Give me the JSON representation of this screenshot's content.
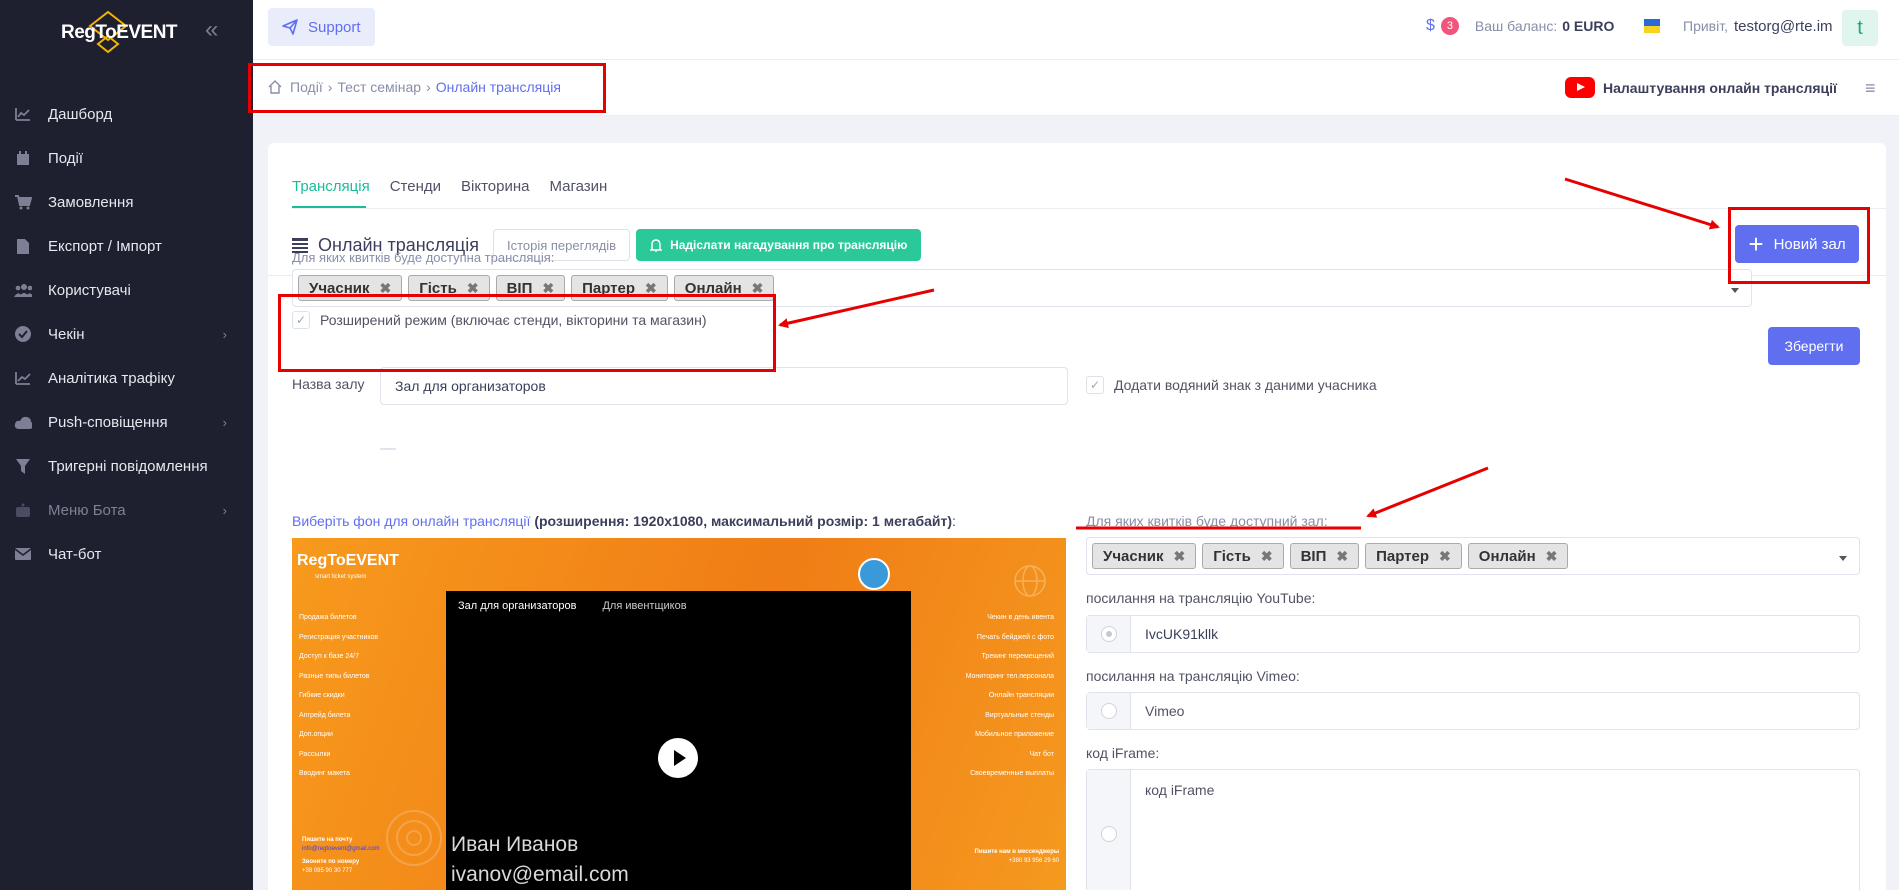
{
  "app": {
    "logo": "RegToEVENT",
    "collapse_icon": "chevron-double-left-icon"
  },
  "sidebar": {
    "items": [
      {
        "label": "Дашборд",
        "icon": "chart-icon"
      },
      {
        "label": "Події",
        "icon": "calendar-icon"
      },
      {
        "label": "Замовлення",
        "icon": "cart-icon"
      },
      {
        "label": "Експорт / Імпорт",
        "icon": "file-icon"
      },
      {
        "label": "Користувачі",
        "icon": "users-icon"
      },
      {
        "label": "Чекін",
        "icon": "check-circle-icon",
        "has_children": true
      },
      {
        "label": "Аналітика трафіку",
        "icon": "analytics-icon"
      },
      {
        "label": "Push-сповіщення",
        "icon": "cloud-icon",
        "has_children": true
      },
      {
        "label": "Тригерні повідомлення",
        "icon": "filter-icon"
      },
      {
        "label": "Меню Бота",
        "icon": "bot-icon",
        "has_children": true,
        "disabled": true
      },
      {
        "label": "Чат-бот",
        "icon": "mail-icon"
      }
    ]
  },
  "topbar": {
    "support_label": "Support",
    "currency_symbol": "$",
    "notifications_count": "3",
    "balance_label": "Ваш баланс:",
    "balance_value": "0 EURO",
    "greeting": "Привіт,",
    "user_email": "testorg@rte.im",
    "avatar_letter": "t"
  },
  "breadcrumb": {
    "items": [
      "Події",
      "Тест семінар",
      "Онлайн трансляція"
    ]
  },
  "page_header": {
    "settings_title": "Налаштування онлайн трансляції"
  },
  "tabs": [
    "Трансляція",
    "Стенди",
    "Вікторина",
    "Магазин"
  ],
  "section": {
    "title": "Онлайн трансляція",
    "history_button": "Історія переглядів",
    "remind_button": "Надіслати нагадування про трансляцію",
    "new_hall_button": "Новий зал"
  },
  "tickets": {
    "label": "Для яких квитків буде доступна трансляція:",
    "tags": [
      "Учасник",
      "Гість",
      "ВІП",
      "Партер",
      "Онлайн"
    ],
    "save_button": "Зберегти",
    "extended_mode": "Розширений режим (включає стенди, вікторини та магазин)"
  },
  "hall": {
    "name_label": "Назва залу",
    "name_value": "Зал для организаторов",
    "watermark_label": "Додати водяний знак з даними учасника",
    "background_label": "Виберіть фон для онлайн трансляції",
    "background_hint": "(розширення: 1920x1080, максимальний розмір: 1 мегабайт)",
    "background_suffix": ":",
    "hall_tickets_label": "Для яких квитків буде доступний зал:",
    "hall_tags": [
      "Учасник",
      "Гість",
      "ВІП",
      "Партер",
      "Онлайн"
    ],
    "youtube_label": "посилання на трансляцію YouTube:",
    "youtube_value": "IvcUK91kllk",
    "vimeo_label": "посилання на трансляцію Vimeo:",
    "vimeo_placeholder": "Vimeo",
    "iframe_label": "код iFrame:",
    "iframe_placeholder": "код iFrame"
  },
  "preview": {
    "logo": "RegToEVENT",
    "logo_sub": "smart ticket system",
    "left_list": [
      "Продажа билетов",
      "Регистрация участников",
      "Доступ к базе 24/7",
      "Разные типы билетов",
      "Гибкие скидки",
      "Апгрейд билета",
      "Доп.опции",
      "Рассылки",
      "Вводинг макета"
    ],
    "right_list": [
      "Чекин в день ивента",
      "Печать бейджей с фото",
      "Трекинг перемещений",
      "Мониторинг тел.персонала",
      "Онлайн трансляции",
      "Виртуальные стенды",
      "Мобильное приложение",
      "Чат бот",
      "Своевременные выплаты"
    ],
    "contact_title": "Пишите на почту",
    "contact_email": "info@regtoevent@gmail.com",
    "call_title": "Звоните по номеру",
    "call_number": "+38 095 90 30 777",
    "messenger_title": "Пишите нам в мессенджеры",
    "messenger_number": "+380 93 956 29 60",
    "video_tabs": [
      "Зал для организаторов",
      "Для ивентщиков"
    ],
    "watermark_name": "Иван Иванов",
    "watermark_email": "ivanov@email.com"
  },
  "colors": {
    "accent": "#5f6ff0",
    "success": "#1abc9c",
    "annotation": "#e60000",
    "sidebar": "#1e1f2f"
  }
}
